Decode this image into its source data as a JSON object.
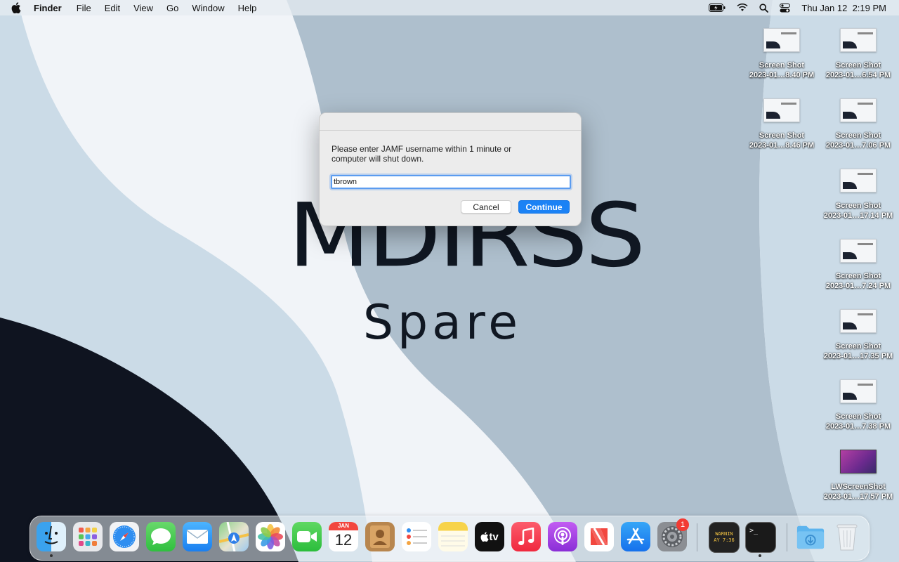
{
  "menubar": {
    "app_name": "Finder",
    "menus": [
      "File",
      "Edit",
      "View",
      "Go",
      "Window",
      "Help"
    ],
    "datetime": "Thu Jan 12  2:19 PM"
  },
  "wallpaper": {
    "brand": "MDIRSS",
    "subtitle": "Spare"
  },
  "desktop_icons": [
    {
      "name": "Screen Shot",
      "date": "2023-01…8.40 PM"
    },
    {
      "name": "Screen Shot",
      "date": "2023-01…6.54 PM"
    },
    {
      "name": "Screen Shot",
      "date": "2023-01…8.46 PM"
    },
    {
      "name": "Screen Shot",
      "date": "2023-01…7.06 PM"
    },
    {
      "name": "Screen Shot",
      "date": "2023-01…17.14 PM"
    },
    {
      "name": "Screen Shot",
      "date": "2023-01…7.24 PM"
    },
    {
      "name": "Screen Shot",
      "date": "2023-01…17.35 PM"
    },
    {
      "name": "Screen Shot",
      "date": "2023-01…7.38 PM"
    },
    {
      "name": "LWScreenShot",
      "date": "2023-01…17.57 PM"
    }
  ],
  "dialog": {
    "message": "Please enter JAMF username within 1 minute or computer will shut down.",
    "input_value": "tbrown",
    "cancel_label": "Cancel",
    "continue_label": "Continue"
  },
  "dock": {
    "calendar_month": "JAN",
    "calendar_day": "12",
    "tv_label": "tv",
    "settings_badge": "1",
    "console_text": "WARNIN\nAY 7:36",
    "terminal_prompt": ">_"
  },
  "colors": {
    "accent": "#1b82f5",
    "wallpaper_light": "#cbdbe7",
    "wallpaper_mid": "#aebfcd",
    "wallpaper_white": "#f1f4f8",
    "wallpaper_dark": "#0f1420"
  }
}
